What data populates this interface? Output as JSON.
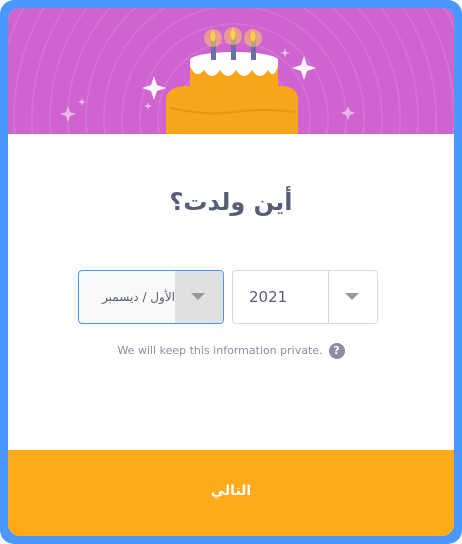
{
  "dialog": {
    "title": "أين ولدت؟",
    "month_select": {
      "value": "الأول / ديسمبر"
    },
    "year_select": {
      "value": "2021"
    },
    "privacy_text": "We will keep this information private.",
    "help_glyph": "?",
    "next_label": "التالي"
  },
  "colors": {
    "frame": "#4c97ff",
    "banner": "#cf63cf",
    "button": "#ffab19",
    "title_text": "#575e75",
    "cake": "#f7a51b"
  },
  "icons": [
    "birthday-cake-icon",
    "sparkle-icon",
    "chevron-down-icon",
    "help-icon"
  ]
}
